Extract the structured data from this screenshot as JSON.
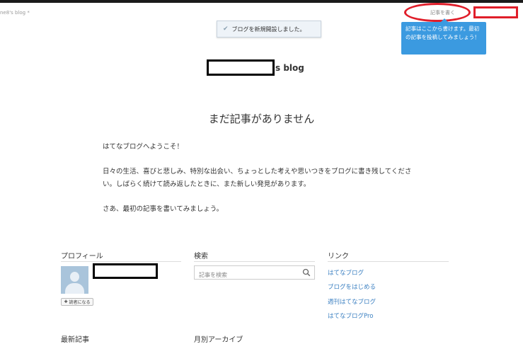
{
  "window": {
    "tab_title": "ne8's blog *"
  },
  "header": {
    "write_link": "記事を書く",
    "notice": "ブログを新規開設しました。",
    "tooltip": "記事はここから書けます。最初の記事を投稿してみましょう！",
    "blog_title_suffix": "s blog"
  },
  "main": {
    "empty_heading": "まだ記事がありません",
    "paragraphs": [
      "はてなブログへようこそ！",
      "日々の生活、喜びと悲しみ、特別な出会い、ちょっとした考えや思いつきをブログに書き残してください。しばらく続けて読み返したときに、また新しい発見があります。",
      "さあ、最初の記事を書いてみましょう。"
    ]
  },
  "sidebar": {
    "profile": {
      "title": "プロフィール",
      "reader_button": "読者になる"
    },
    "search": {
      "title": "検索",
      "placeholder": "記事を検索"
    },
    "links": {
      "title": "リンク",
      "items": [
        "はてなブログ",
        "ブログをはじめる",
        "週刊はてなブログ",
        "はてなブログPro"
      ]
    },
    "recent": {
      "title": "最新記事"
    },
    "archive": {
      "title": "月別アーカイブ"
    }
  },
  "colors": {
    "accent": "#3b9ae0",
    "link": "#3a7fc1",
    "annotation": "#e01e2a"
  },
  "icons": {
    "notice": "check-icon",
    "search": "search-icon",
    "reader": "plus-icon"
  }
}
